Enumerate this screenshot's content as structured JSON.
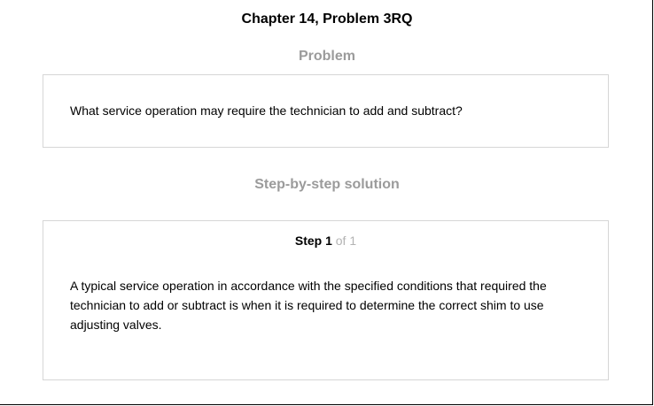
{
  "header": {
    "title": "Chapter 14, Problem 3RQ"
  },
  "problem": {
    "heading": "Problem",
    "text": "What service operation may require the technician to add and subtract?"
  },
  "solution": {
    "heading": "Step-by-step solution",
    "step_label": "Step 1",
    "step_of": "of 1",
    "text": "A typical service operation in accordance with the specified conditions that required the technician to add or subtract is when it is required to determine the correct shim to use adjusting valves."
  },
  "colors": {
    "heading_gray": "#9b9b9b",
    "border_gray": "#d6d6d6",
    "step_of_gray": "#b3b3b3"
  }
}
